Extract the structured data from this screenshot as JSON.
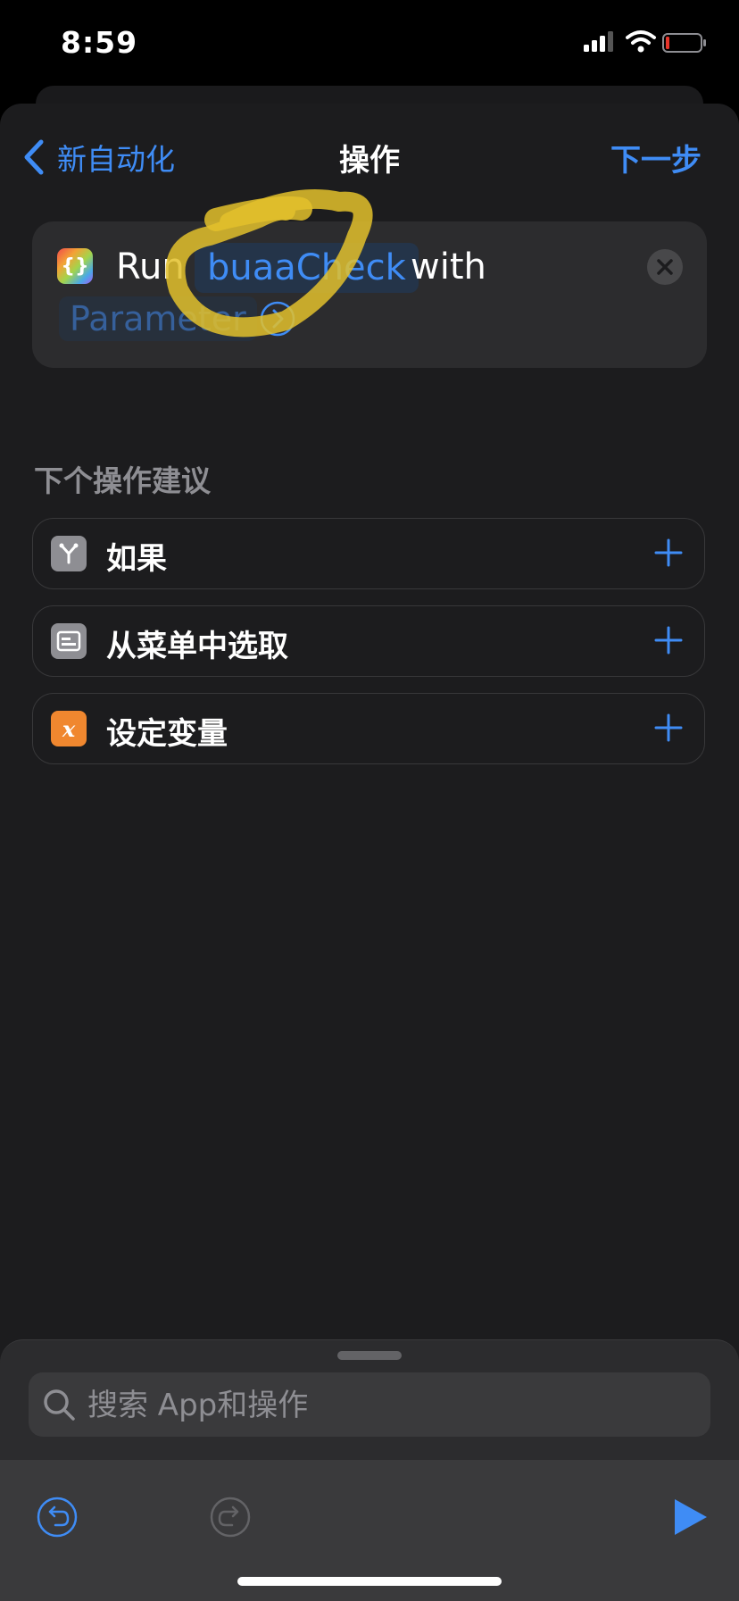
{
  "status_bar": {
    "time": "8:59"
  },
  "nav": {
    "back_label": "新自动化",
    "title": "操作",
    "next_label": "下一步"
  },
  "action": {
    "run_word": "Run",
    "shortcut_name": "buaaCheck",
    "with_word": "with",
    "parameter_label": "Parameter"
  },
  "suggestions": {
    "title": "下个操作建议",
    "items": [
      {
        "label": "如果",
        "icon": "branch-icon",
        "color": "#8e8e93"
      },
      {
        "label": "从菜单中选取",
        "icon": "menu-icon",
        "color": "#8e8e93"
      },
      {
        "label": "设定变量",
        "icon": "variable-icon",
        "color": "#f0872f"
      }
    ]
  },
  "search": {
    "placeholder": "搜索 App和操作"
  },
  "colors": {
    "accent": "#3f8cf5",
    "highlight": "#e3c12c",
    "background": "#1c1c1e"
  }
}
